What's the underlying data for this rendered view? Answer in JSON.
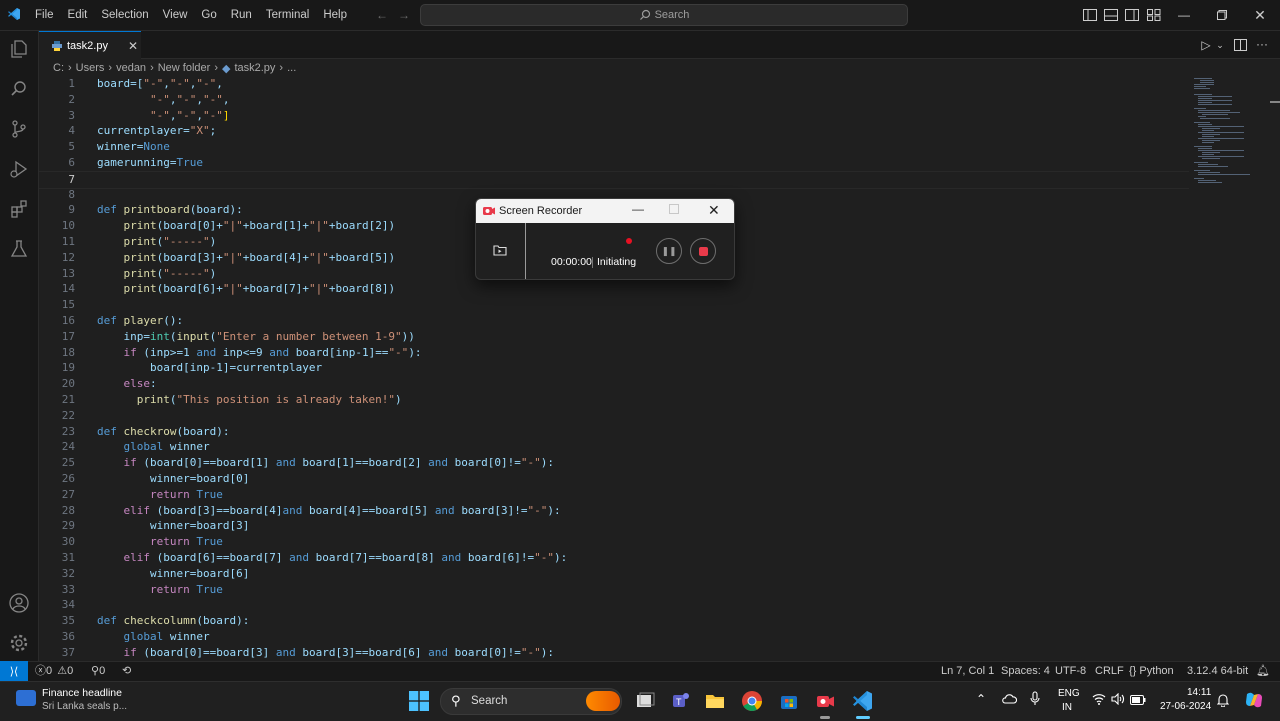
{
  "menu": [
    "File",
    "Edit",
    "Selection",
    "View",
    "Go",
    "Run",
    "Terminal",
    "Help"
  ],
  "search": {
    "label": "Search"
  },
  "tab": {
    "filename": "task2.py"
  },
  "breadcrumb": [
    "C:",
    "Users",
    "vedan",
    "New folder",
    "task2.py",
    "..."
  ],
  "code": [
    [
      [
        "board=[",
        "v"
      ],
      [
        "\"-\"",
        "s"
      ],
      [
        ",",
        "v"
      ],
      [
        "\"-\"",
        "s"
      ],
      [
        ",",
        "v"
      ],
      [
        "\"-\"",
        "s"
      ],
      [
        ",",
        "v"
      ]
    ],
    [
      [
        "        ",
        "v"
      ],
      [
        "\"-\"",
        "s"
      ],
      [
        ",",
        "v"
      ],
      [
        "\"-\"",
        "s"
      ],
      [
        ",",
        "v"
      ],
      [
        "\"-\"",
        "s"
      ],
      [
        ",",
        "v"
      ]
    ],
    [
      [
        "        ",
        "v"
      ],
      [
        "\"-\"",
        "s"
      ],
      [
        ",",
        "v"
      ],
      [
        "\"-\"",
        "s"
      ],
      [
        ",",
        "v"
      ],
      [
        "\"-\"",
        "s"
      ],
      [
        "]",
        "b"
      ]
    ],
    [
      [
        "currentplayer=",
        "v"
      ],
      [
        "\"X\"",
        "s"
      ],
      [
        ";",
        "v"
      ]
    ],
    [
      [
        "winner=",
        "v"
      ],
      [
        "None",
        "k"
      ]
    ],
    [
      [
        "gamerunning=",
        "v"
      ],
      [
        "True",
        "k"
      ]
    ],
    [
      [
        "",
        "v"
      ]
    ],
    [
      [
        "",
        "v"
      ]
    ],
    [
      [
        "def ",
        "k"
      ],
      [
        "printboard",
        "f"
      ],
      [
        "(board):",
        "v"
      ]
    ],
    [
      [
        "    ",
        "v"
      ],
      [
        "print",
        "f"
      ],
      [
        "(board[0]+",
        "v"
      ],
      [
        "\"|\"",
        "s"
      ],
      [
        "+board[1]+",
        "v"
      ],
      [
        "\"|\"",
        "s"
      ],
      [
        "+board[2])",
        "v"
      ]
    ],
    [
      [
        "    ",
        "v"
      ],
      [
        "print",
        "f"
      ],
      [
        "(",
        "v"
      ],
      [
        "\"-----\"",
        "s"
      ],
      [
        ")",
        "v"
      ]
    ],
    [
      [
        "    ",
        "v"
      ],
      [
        "print",
        "f"
      ],
      [
        "(board[3]+",
        "v"
      ],
      [
        "\"|\"",
        "s"
      ],
      [
        "+board[4]+",
        "v"
      ],
      [
        "\"|\"",
        "s"
      ],
      [
        "+board[5])",
        "v"
      ]
    ],
    [
      [
        "    ",
        "v"
      ],
      [
        "print",
        "f"
      ],
      [
        "(",
        "v"
      ],
      [
        "\"-----\"",
        "s"
      ],
      [
        ")",
        "v"
      ]
    ],
    [
      [
        "    ",
        "v"
      ],
      [
        "print",
        "f"
      ],
      [
        "(board[6]+",
        "v"
      ],
      [
        "\"|\"",
        "s"
      ],
      [
        "+board[7]+",
        "v"
      ],
      [
        "\"|\"",
        "s"
      ],
      [
        "+board[8])",
        "v"
      ]
    ],
    [
      [
        "",
        "v"
      ]
    ],
    [
      [
        "def ",
        "k"
      ],
      [
        "player",
        "f"
      ],
      [
        "():",
        "v"
      ]
    ],
    [
      [
        "    inp=",
        "v"
      ],
      [
        "int",
        "t"
      ],
      [
        "(",
        "v"
      ],
      [
        "input",
        "f"
      ],
      [
        "(",
        "v"
      ],
      [
        "\"Enter a number between 1-9\"",
        "s"
      ],
      [
        "))",
        "v"
      ]
    ],
    [
      [
        "    ",
        "v"
      ],
      [
        "if ",
        "c"
      ],
      [
        "(inp>=1 ",
        "v"
      ],
      [
        "and ",
        "k"
      ],
      [
        "inp<=9 ",
        "v"
      ],
      [
        "and ",
        "k"
      ],
      [
        "board[inp-1]==",
        "v"
      ],
      [
        "\"-\"",
        "s"
      ],
      [
        "):",
        "v"
      ]
    ],
    [
      [
        "        board[inp-1]=currentplayer",
        "v"
      ]
    ],
    [
      [
        "    ",
        "v"
      ],
      [
        "else",
        "c"
      ],
      [
        ":",
        "v"
      ]
    ],
    [
      [
        "      ",
        "v"
      ],
      [
        "print",
        "f"
      ],
      [
        "(",
        "v"
      ],
      [
        "\"This position is already taken!\"",
        "s"
      ],
      [
        ")",
        "v"
      ]
    ],
    [
      [
        "",
        "v"
      ]
    ],
    [
      [
        "def ",
        "k"
      ],
      [
        "checkrow",
        "f"
      ],
      [
        "(board):",
        "v"
      ]
    ],
    [
      [
        "    ",
        "v"
      ],
      [
        "global ",
        "k"
      ],
      [
        "winner",
        "v"
      ]
    ],
    [
      [
        "    ",
        "v"
      ],
      [
        "if ",
        "c"
      ],
      [
        "(board[0]==board[1] ",
        "v"
      ],
      [
        "and ",
        "k"
      ],
      [
        "board[1]==board[2] ",
        "v"
      ],
      [
        "and ",
        "k"
      ],
      [
        "board[0]!=",
        "v"
      ],
      [
        "\"-\"",
        "s"
      ],
      [
        "):",
        "v"
      ]
    ],
    [
      [
        "        winner=board[0]",
        "v"
      ]
    ],
    [
      [
        "        ",
        "v"
      ],
      [
        "return ",
        "c"
      ],
      [
        "True",
        "k"
      ]
    ],
    [
      [
        "    ",
        "v"
      ],
      [
        "elif ",
        "c"
      ],
      [
        "(board[3]==board[4]",
        "v"
      ],
      [
        "and ",
        "k"
      ],
      [
        "board[4]==board[5] ",
        "v"
      ],
      [
        "and ",
        "k"
      ],
      [
        "board[3]!=",
        "v"
      ],
      [
        "\"-\"",
        "s"
      ],
      [
        "):",
        "v"
      ]
    ],
    [
      [
        "        winner=board[3]",
        "v"
      ]
    ],
    [
      [
        "        ",
        "v"
      ],
      [
        "return ",
        "c"
      ],
      [
        "True",
        "k"
      ]
    ],
    [
      [
        "    ",
        "v"
      ],
      [
        "elif ",
        "c"
      ],
      [
        "(board[6]==board[7] ",
        "v"
      ],
      [
        "and ",
        "k"
      ],
      [
        "board[7]==board[8] ",
        "v"
      ],
      [
        "and ",
        "k"
      ],
      [
        "board[6]!=",
        "v"
      ],
      [
        "\"-\"",
        "s"
      ],
      [
        "):",
        "v"
      ]
    ],
    [
      [
        "        winner=board[6]",
        "v"
      ]
    ],
    [
      [
        "        ",
        "v"
      ],
      [
        "return ",
        "c"
      ],
      [
        "True",
        "k"
      ]
    ],
    [
      [
        "",
        "v"
      ]
    ],
    [
      [
        "def ",
        "k"
      ],
      [
        "checkcolumn",
        "f"
      ],
      [
        "(board):",
        "v"
      ]
    ],
    [
      [
        "    ",
        "v"
      ],
      [
        "global ",
        "k"
      ],
      [
        "winner",
        "v"
      ]
    ],
    [
      [
        "    ",
        "v"
      ],
      [
        "if ",
        "c"
      ],
      [
        "(board[0]==board[3] ",
        "v"
      ],
      [
        "and ",
        "k"
      ],
      [
        "board[3]==board[6] ",
        "v"
      ],
      [
        "and ",
        "k"
      ],
      [
        "board[0]!=",
        "v"
      ],
      [
        "\"-\"",
        "s"
      ],
      [
        "):",
        "v"
      ]
    ]
  ],
  "colors": {
    "v": "#9cdcfe",
    "s": "#ce9178",
    "k": "#569cd6",
    "f": "#dcdcaa",
    "t": "#4ec9b0",
    "c": "#c586c0",
    "b": "#ffd700",
    "plain": "#cccccc"
  },
  "active_line": 7,
  "recorder": {
    "title": "Screen Recorder",
    "time": "00:00:00",
    "status": "Initiating"
  },
  "status": {
    "errors": "0",
    "warnings": "0",
    "ports": "0",
    "position": "Ln 7, Col 1",
    "spaces": "Spaces: 4",
    "encoding": "UTF-8",
    "eol": "CRLF",
    "language": "Python",
    "interpreter": "3.12.4 64-bit"
  },
  "taskbar": {
    "news_title": "Finance headline",
    "news_sub": "Sri Lanka seals p...",
    "search": "Search",
    "lang": "ENG",
    "region": "IN",
    "time": "14:11",
    "date": "27-06-2024"
  }
}
